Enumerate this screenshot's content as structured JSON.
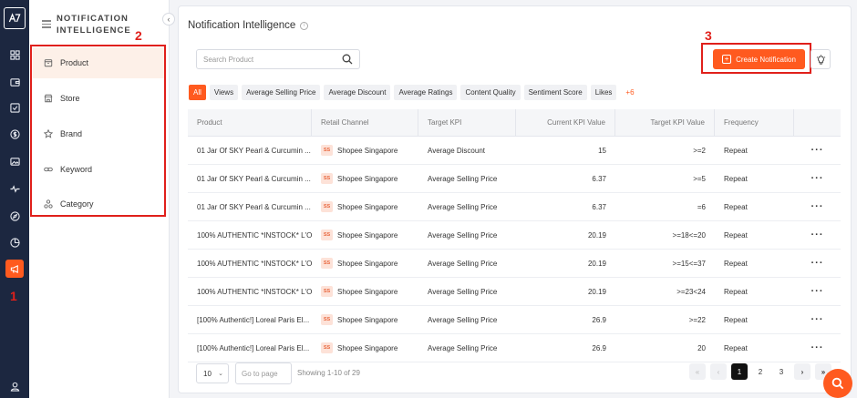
{
  "annotations": {
    "rail": "1",
    "sidebar": "2",
    "create": "3"
  },
  "sidebar": {
    "title_line1": "NOTIFICATION",
    "title_line2": "INTELLIGENCE",
    "collapse_glyph": "‹",
    "items": [
      {
        "label": "Product",
        "icon": "box-icon"
      },
      {
        "label": "Store",
        "icon": "store-icon"
      },
      {
        "label": "Brand",
        "icon": "star-icon"
      },
      {
        "label": "Keyword",
        "icon": "link-icon"
      },
      {
        "label": "Category",
        "icon": "category-icon"
      }
    ]
  },
  "main": {
    "title": "Notification Intelligence",
    "search_placeholder": "Search Product",
    "create_label": "Create Notification",
    "chips": [
      "All",
      "Views",
      "Average Selling Price",
      "Average Discount",
      "Average Ratings",
      "Content Quality",
      "Sentiment Score",
      "Likes"
    ],
    "chips_more": "+6"
  },
  "table": {
    "columns": [
      "Product",
      "Retail Channel",
      "Target KPI",
      "Current KPI Value",
      "Target KPI Value",
      "Frequency",
      ""
    ],
    "channel_badge": "SS",
    "rows": [
      {
        "product": "01 Jar Of SKY Pearl & Curcumin ...",
        "channel": "Shopee Singapore",
        "kpi": "Average Discount",
        "current": "15",
        "target": ">=2",
        "frequency": "Repeat"
      },
      {
        "product": "01 Jar Of SKY Pearl & Curcumin ...",
        "channel": "Shopee Singapore",
        "kpi": "Average Selling Price",
        "current": "6.37",
        "target": ">=5",
        "frequency": "Repeat"
      },
      {
        "product": "01 Jar Of SKY Pearl & Curcumin ...",
        "channel": "Shopee Singapore",
        "kpi": "Average Selling Price",
        "current": "6.37",
        "target": "=6",
        "frequency": "Repeat"
      },
      {
        "product": "100% AUTHENTIC *INSTOCK* L'OR...",
        "channel": "Shopee Singapore",
        "kpi": "Average Selling Price",
        "current": "20.19",
        "target": ">=18<=20",
        "frequency": "Repeat"
      },
      {
        "product": "100% AUTHENTIC *INSTOCK* L'OR...",
        "channel": "Shopee Singapore",
        "kpi": "Average Selling Price",
        "current": "20.19",
        "target": ">=15<=37",
        "frequency": "Repeat"
      },
      {
        "product": "100% AUTHENTIC *INSTOCK* L'OR...",
        "channel": "Shopee Singapore",
        "kpi": "Average Selling Price",
        "current": "20.19",
        "target": ">=23<24",
        "frequency": "Repeat"
      },
      {
        "product": "[100% Authentic!] Loreal Paris El...",
        "channel": "Shopee Singapore",
        "kpi": "Average Selling Price",
        "current": "26.9",
        "target": ">=22",
        "frequency": "Repeat"
      },
      {
        "product": "[100% Authentic!] Loreal Paris El...",
        "channel": "Shopee Singapore",
        "kpi": "Average Selling Price",
        "current": "26.9",
        "target": "20",
        "frequency": "Repeat"
      }
    ]
  },
  "footer": {
    "page_size": "10",
    "page_size_glyph": "⌄",
    "goto_placeholder": "Go to page",
    "showing": "Showing 1-10 of 29",
    "pages": [
      "«",
      "‹",
      "1",
      "2",
      "3",
      "›",
      "»"
    ]
  },
  "colors": {
    "accent": "#ff5a1f",
    "rail": "#1c2740",
    "annotation": "#e0201b"
  }
}
